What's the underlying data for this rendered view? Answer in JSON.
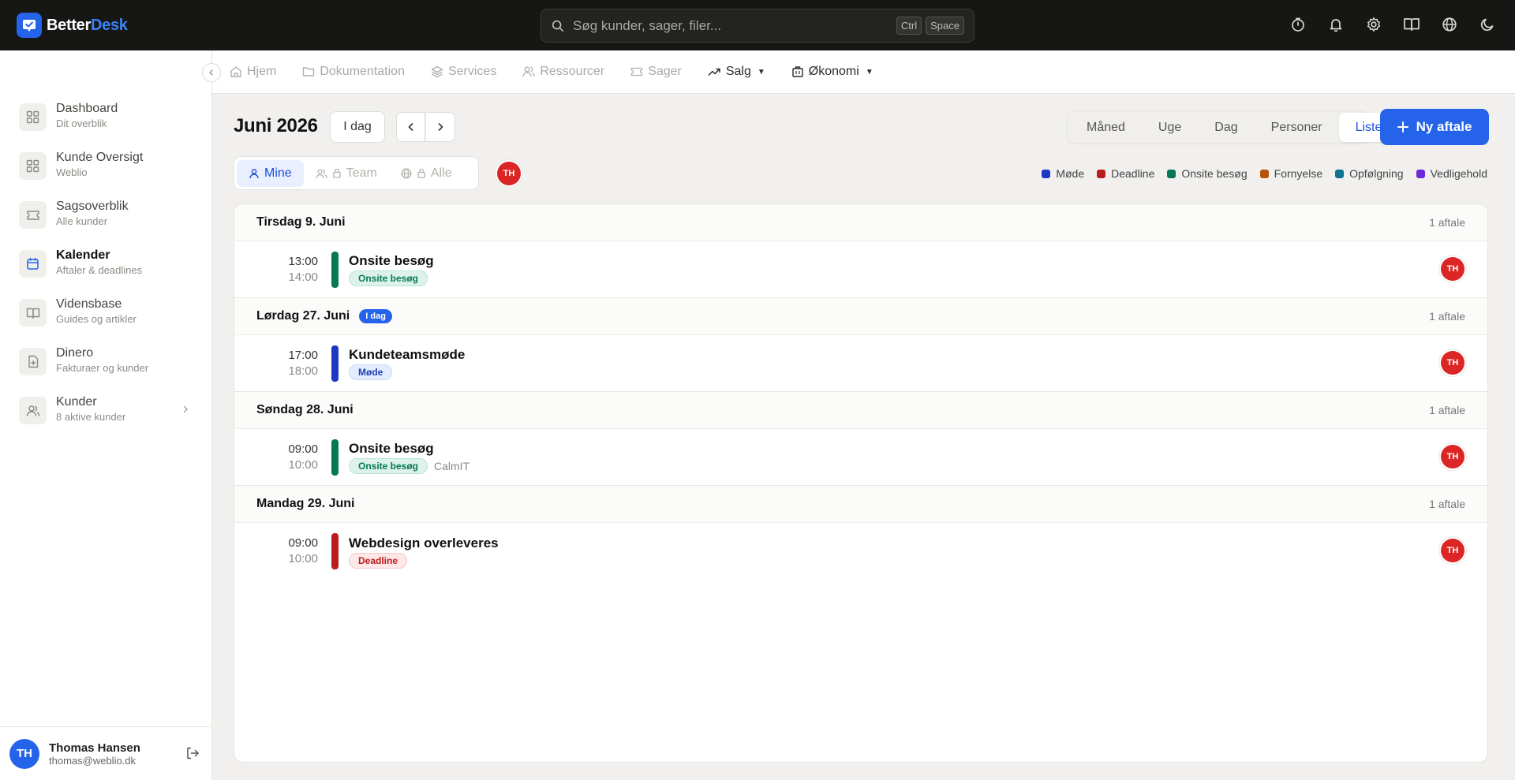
{
  "app": {
    "brand_first": "Better",
    "brand_second": "Desk",
    "brand_color": "#2563eb"
  },
  "search": {
    "placeholder": "Søg kunder, sager, filer...",
    "shortcut_1": "Ctrl",
    "shortcut_2": "Space"
  },
  "topbar_icons": [
    "timer-icon",
    "bell-icon",
    "gear-icon",
    "book-icon",
    "globe-icon",
    "moon-icon"
  ],
  "subnav": {
    "items": [
      {
        "label": "Hjem",
        "icon": "home-icon"
      },
      {
        "label": "Dokumentation",
        "icon": "folder-icon"
      },
      {
        "label": "Services",
        "icon": "layers-icon"
      },
      {
        "label": "Ressourcer",
        "icon": "users-icon"
      },
      {
        "label": "Sager",
        "icon": "ticket-icon"
      },
      {
        "label": "Salg",
        "icon": "trending-up-icon"
      },
      {
        "label": "Økonomi",
        "icon": "building-icon"
      }
    ]
  },
  "sidebar": {
    "items": [
      {
        "title": "Dashboard",
        "subtitle": "Dit overblik",
        "icon": "grid-icon"
      },
      {
        "title": "Kunde Oversigt",
        "subtitle": "Weblio",
        "icon": "grid-icon"
      },
      {
        "title": "Sagsoverblik",
        "subtitle": "Alle kunder",
        "icon": "ticket-icon"
      },
      {
        "title": "Kalender",
        "subtitle": "Aftaler & deadlines",
        "icon": "calendar-icon",
        "active": true
      },
      {
        "title": "Vidensbase",
        "subtitle": "Guides og artikler",
        "icon": "book-icon"
      },
      {
        "title": "Dinero",
        "subtitle": "Fakturaer og kunder",
        "icon": "file-plus-icon"
      },
      {
        "title": "Kunder",
        "subtitle": "8 aktive kunder",
        "icon": "users-icon"
      }
    ]
  },
  "user": {
    "initials": "TH",
    "name": "Thomas Hansen",
    "email": "thomas@weblio.dk"
  },
  "calendar": {
    "title": "Juni 2026",
    "today_label": "I dag",
    "views": [
      "Måned",
      "Uge",
      "Dag",
      "Personer",
      "Liste"
    ],
    "active_view": "Liste",
    "new_button": "Ny aftale",
    "scope": [
      "Mine",
      "Team",
      "Alle"
    ],
    "active_scope": "Mine",
    "avatar_initials": "TH"
  },
  "legend": [
    {
      "label": "Møde",
      "color": "#1d39c4"
    },
    {
      "label": "Deadline",
      "color": "#b91c1c"
    },
    {
      "label": "Onsite besøg",
      "color": "#047857"
    },
    {
      "label": "Fornyelse",
      "color": "#b45309"
    },
    {
      "label": "Opfølgning",
      "color": "#0e7490"
    },
    {
      "label": "Vedligehold",
      "color": "#6d28d9"
    }
  ],
  "days": [
    {
      "title": "Tirsdag 9. Juni",
      "badge": "",
      "count": "1 aftale",
      "events": [
        {
          "start": "13:00",
          "end": "14:00",
          "title": "Onsite besøg",
          "tag": "Onsite besøg",
          "tag_type": "onsite",
          "customer": "",
          "color": "#047857",
          "initials": "TH"
        }
      ]
    },
    {
      "title": "Lørdag 27. Juni",
      "badge": "I dag",
      "count": "1 aftale",
      "events": [
        {
          "start": "17:00",
          "end": "18:00",
          "title": "Kundeteamsmøde",
          "tag": "Møde",
          "tag_type": "mode",
          "customer": "",
          "color": "#1d39c4",
          "initials": "TH"
        }
      ]
    },
    {
      "title": "Søndag 28. Juni",
      "badge": "",
      "count": "1 aftale",
      "events": [
        {
          "start": "09:00",
          "end": "10:00",
          "title": "Onsite besøg",
          "tag": "Onsite besøg",
          "tag_type": "onsite",
          "customer": "CalmIT",
          "color": "#047857",
          "initials": "TH"
        }
      ]
    },
    {
      "title": "Mandag 29. Juni",
      "badge": "",
      "count": "1 aftale",
      "events": [
        {
          "start": "09:00",
          "end": "10:00",
          "title": "Webdesign overleveres",
          "tag": "Deadline",
          "tag_type": "deadline",
          "customer": "",
          "color": "#b91c1c",
          "initials": "TH"
        }
      ]
    }
  ]
}
